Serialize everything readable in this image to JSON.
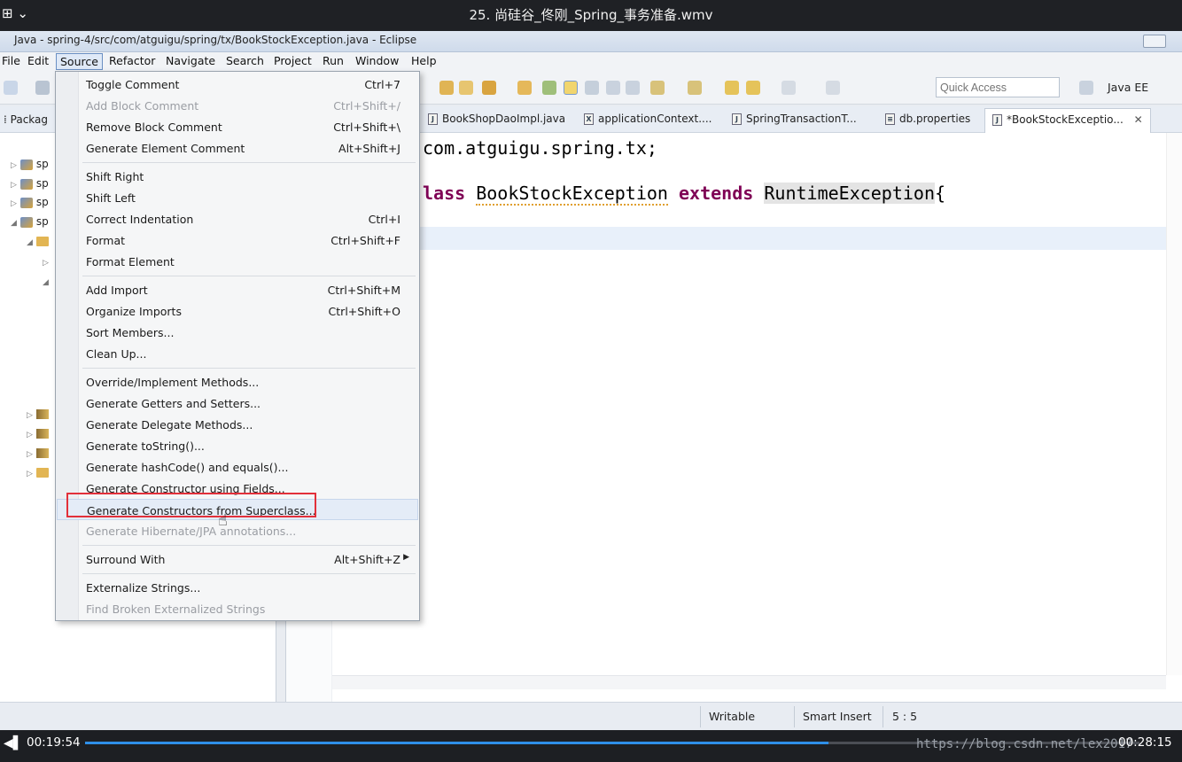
{
  "player": {
    "title": "25. 尚硅谷_佟刚_Spring_事务准备.wmv",
    "menu_icon": "⊞ ⌄",
    "current_time": "00:19:54",
    "total_time": "00:28:15",
    "progress_percent": 70.5,
    "watermark": "https://blog.csdn.net/lex2017",
    "progress_color": "#2f8fe8"
  },
  "window": {
    "title": "Java - spring-4/src/com/atguigu/spring/tx/BookStockException.java - Eclipse"
  },
  "menubar": {
    "items": [
      "File",
      "Edit",
      "Source",
      "Refactor",
      "Navigate",
      "Search",
      "Project",
      "Run",
      "Window",
      "Help"
    ],
    "active": "Source"
  },
  "toolbar": {
    "quick_access_placeholder": "Quick Access",
    "perspective": "Java EE"
  },
  "package_explorer": {
    "tab_label": "Packag",
    "projects": [
      "sp",
      "sp",
      "sp",
      "sp"
    ]
  },
  "editor": {
    "tabs": [
      {
        "label": "BookShopDaoImpl.java",
        "icon": "J"
      },
      {
        "label": "applicationContext....",
        "icon": "X"
      },
      {
        "label": "SpringTransactionT...",
        "icon": "J"
      },
      {
        "label": "db.properties",
        "icon": "≡"
      },
      {
        "label": "*BookStockExceptio...",
        "icon": "J",
        "active": true
      }
    ],
    "tab_close": "✕",
    "code": {
      "line1": "com.atguigu.spring.tx;",
      "line2_kw1": "lass",
      "line2_name": "BookStockException",
      "line2_kw2": "extends",
      "line2_super": "RuntimeException",
      "line2_brace": "{"
    }
  },
  "source_menu": {
    "items": [
      {
        "label": "Toggle Comment",
        "shortcut": "Ctrl+7",
        "enabled": true
      },
      {
        "label": "Add Block Comment",
        "shortcut": "Ctrl+Shift+/",
        "enabled": false
      },
      {
        "label": "Remove Block Comment",
        "shortcut": "Ctrl+Shift+\\",
        "enabled": true
      },
      {
        "label": "Generate Element Comment",
        "shortcut": "Alt+Shift+J",
        "enabled": true
      },
      {
        "label": "Shift Right",
        "shortcut": "",
        "enabled": true
      },
      {
        "label": "Shift Left",
        "shortcut": "",
        "enabled": true
      },
      {
        "label": "Correct Indentation",
        "shortcut": "Ctrl+I",
        "enabled": true
      },
      {
        "label": "Format",
        "shortcut": "Ctrl+Shift+F",
        "enabled": true
      },
      {
        "label": "Format Element",
        "shortcut": "",
        "enabled": true
      },
      {
        "label": "Add Import",
        "shortcut": "Ctrl+Shift+M",
        "enabled": true
      },
      {
        "label": "Organize Imports",
        "shortcut": "Ctrl+Shift+O",
        "enabled": true
      },
      {
        "label": "Sort Members...",
        "shortcut": "",
        "enabled": true
      },
      {
        "label": "Clean Up...",
        "shortcut": "",
        "enabled": true
      },
      {
        "label": "Override/Implement Methods...",
        "shortcut": "",
        "enabled": true
      },
      {
        "label": "Generate Getters and Setters...",
        "shortcut": "",
        "enabled": true
      },
      {
        "label": "Generate Delegate Methods...",
        "shortcut": "",
        "enabled": true
      },
      {
        "label": "Generate toString()...",
        "shortcut": "",
        "enabled": true
      },
      {
        "label": "Generate hashCode() and equals()...",
        "shortcut": "",
        "enabled": true
      },
      {
        "label": "Generate Constructor using Fields...",
        "shortcut": "",
        "enabled": true
      },
      {
        "label": "Generate Constructors from Superclass...",
        "shortcut": "",
        "enabled": true,
        "hover": true
      },
      {
        "label": "Generate Hibernate/JPA annotations...",
        "shortcut": "",
        "enabled": false
      },
      {
        "label": "Surround With",
        "shortcut": "Alt+Shift+Z",
        "enabled": true,
        "submenu": true
      },
      {
        "label": "Externalize Strings...",
        "shortcut": "",
        "enabled": true
      },
      {
        "label": "Find Broken Externalized Strings",
        "shortcut": "",
        "enabled": false
      }
    ],
    "highlight_color": "#e2303a"
  },
  "statusbar": {
    "writable": "Writable",
    "insert_mode": "Smart Insert",
    "position": "5 : 5"
  }
}
